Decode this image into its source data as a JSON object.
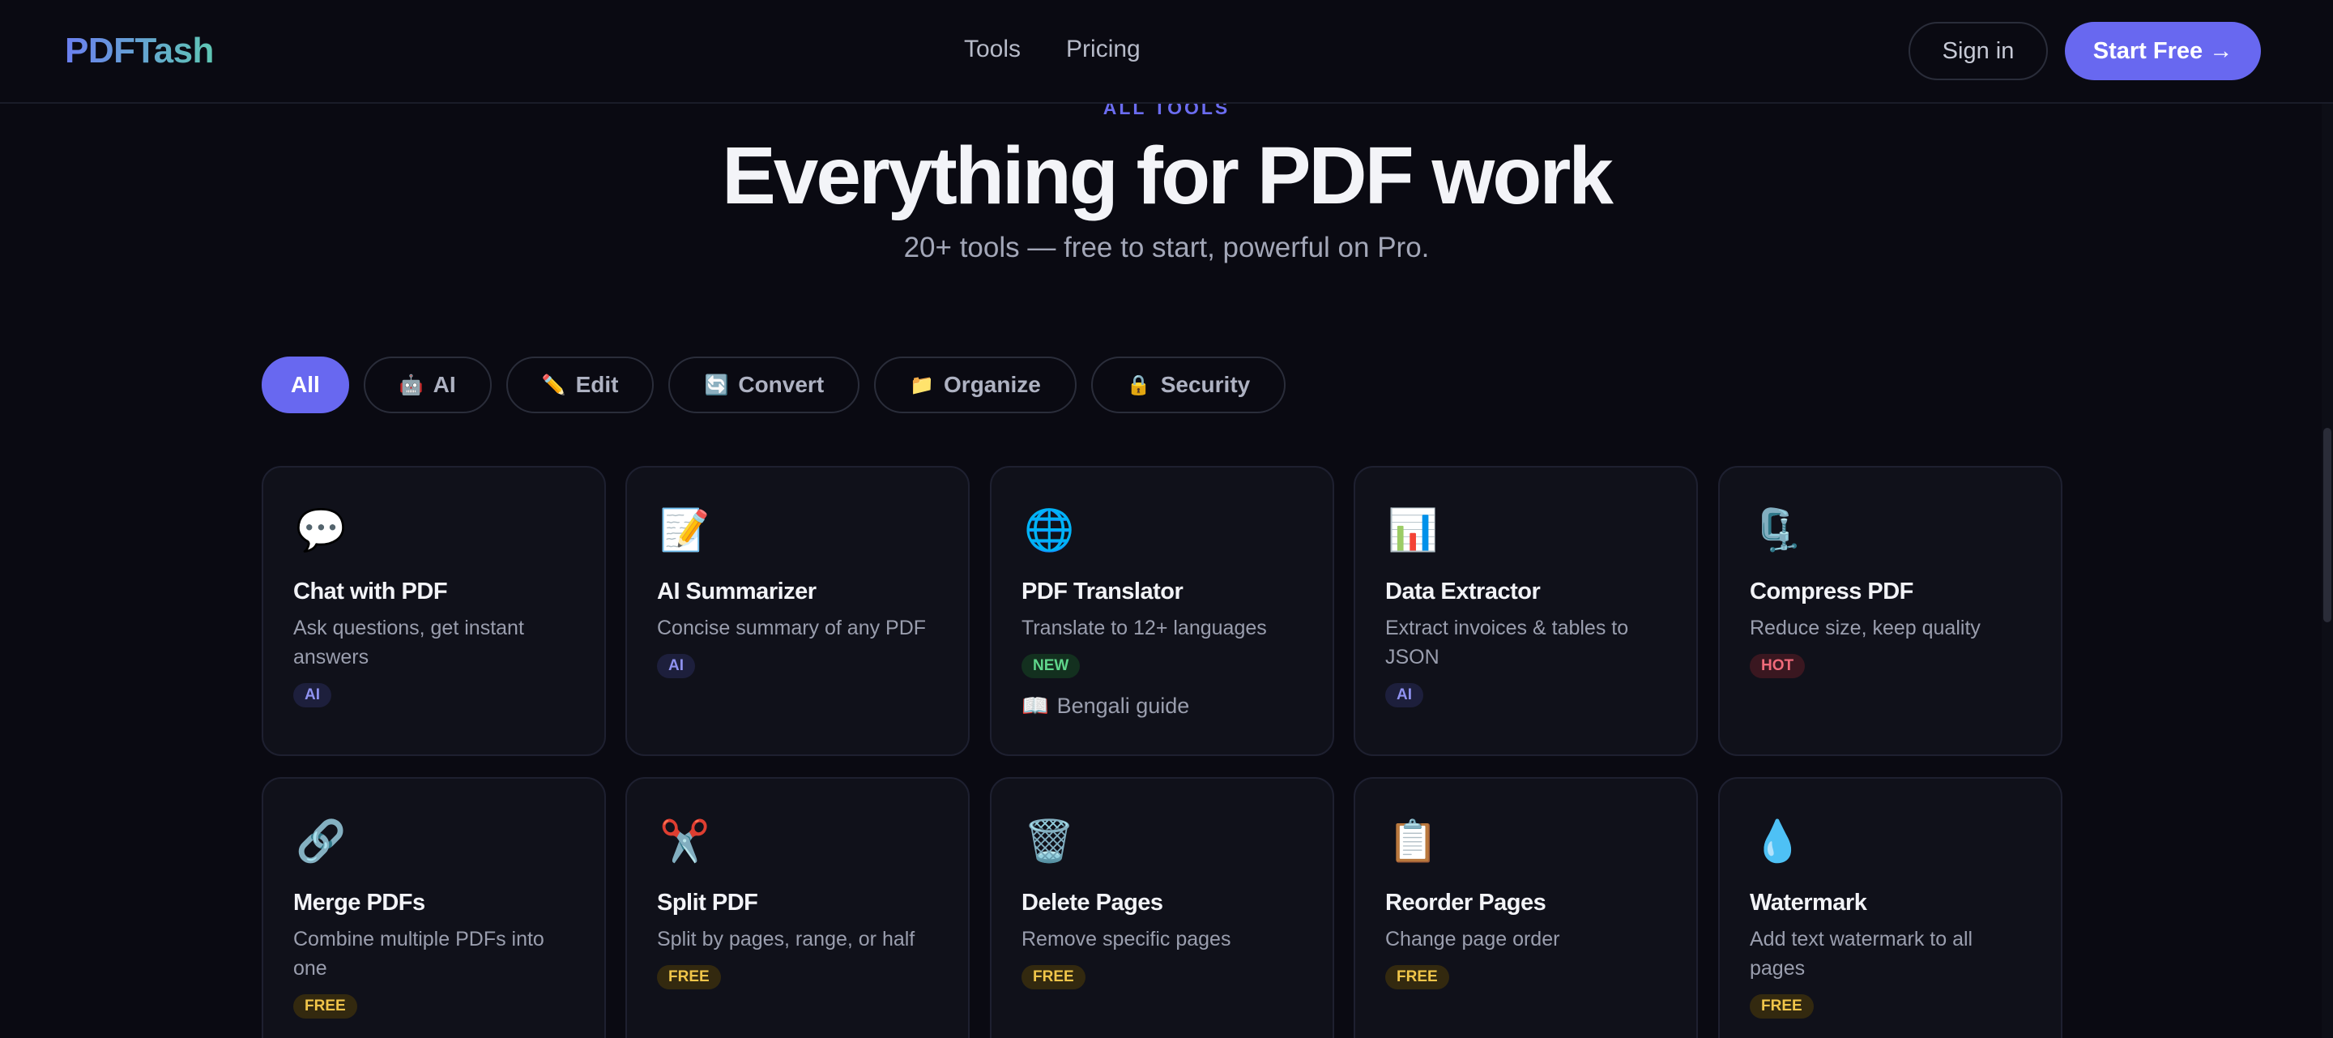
{
  "nav": {
    "logo": "PDFTash",
    "links": [
      "Tools",
      "Pricing"
    ],
    "signin": "Sign in",
    "start": "Start Free →"
  },
  "hero": {
    "eyebrow": "ALL TOOLS",
    "title": "Everything for PDF work",
    "subtitle": "20+ tools — free to start, powerful on Pro."
  },
  "filters": [
    {
      "label": "All",
      "icon": "",
      "active": true
    },
    {
      "label": "AI",
      "icon": "🤖"
    },
    {
      "label": "Edit",
      "icon": "✏️"
    },
    {
      "label": "Convert",
      "icon": "🔄"
    },
    {
      "label": "Organize",
      "icon": "📁"
    },
    {
      "label": "Security",
      "icon": "🔒"
    }
  ],
  "tools": [
    {
      "icon": "💬",
      "title": "Chat with PDF",
      "desc": "Ask questions, get instant answers",
      "badge": "AI"
    },
    {
      "icon": "📝",
      "title": "AI Summarizer",
      "desc": "Concise summary of any PDF",
      "badge": "AI"
    },
    {
      "icon": "🌐",
      "title": "PDF Translator",
      "desc": "Translate to 12+ languages",
      "badge": "NEW",
      "extra_icon": "📖",
      "extra": "Bengali guide"
    },
    {
      "icon": "📊",
      "title": "Data Extractor",
      "desc": "Extract invoices & tables to JSON",
      "badge": "AI"
    },
    {
      "icon": "🗜️",
      "title": "Compress PDF",
      "desc": "Reduce size, keep quality",
      "badge": "HOT"
    },
    {
      "icon": "🔗",
      "title": "Merge PDFs",
      "desc": "Combine multiple PDFs into one",
      "badge": "FREE"
    },
    {
      "icon": "✂️",
      "title": "Split PDF",
      "desc": "Split by pages, range, or half",
      "badge": "FREE"
    },
    {
      "icon": "🗑️",
      "title": "Delete Pages",
      "desc": "Remove specific pages",
      "badge": "FREE"
    },
    {
      "icon": "📋",
      "title": "Reorder Pages",
      "desc": "Change page order",
      "badge": "FREE"
    },
    {
      "icon": "💧",
      "title": "Watermark",
      "desc": "Add text watermark to all pages",
      "badge": "FREE"
    }
  ]
}
